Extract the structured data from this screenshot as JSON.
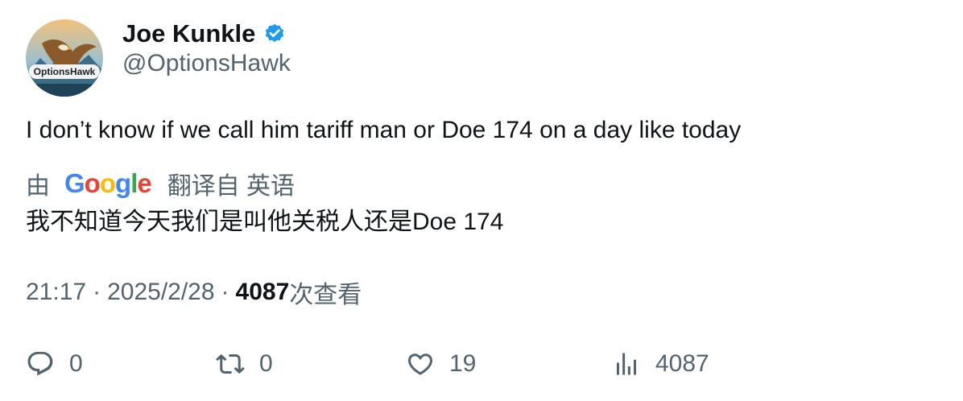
{
  "author": {
    "display_name": "Joe Kunkle",
    "handle": "@OptionsHawk",
    "avatar_text": "OptionsHawk",
    "verified": true,
    "verified_color": "#1d9bf0"
  },
  "tweet": {
    "text": "I don’t know if we call him tariff man or Doe 174 on a day like today"
  },
  "translation": {
    "prefix": "由",
    "provider": [
      "G",
      "o",
      "o",
      "g",
      "l",
      "e"
    ],
    "suffix": "翻译自 英语",
    "text": "我不知道今天我们是叫他关税人还是Doe 174"
  },
  "meta": {
    "time": "21:17",
    "separator": "·",
    "date": "2025/2/28",
    "views_count": "4087",
    "views_label": "次查看"
  },
  "actions": {
    "reply_count": "0",
    "retweet_count": "0",
    "like_count": "19",
    "views_count": "4087"
  },
  "colors": {
    "text_primary": "#0f1419",
    "text_secondary": "#536471",
    "google_blue": "#4285F4",
    "google_red": "#EA4335",
    "google_yellow": "#FBBC05",
    "google_green": "#34A853"
  }
}
